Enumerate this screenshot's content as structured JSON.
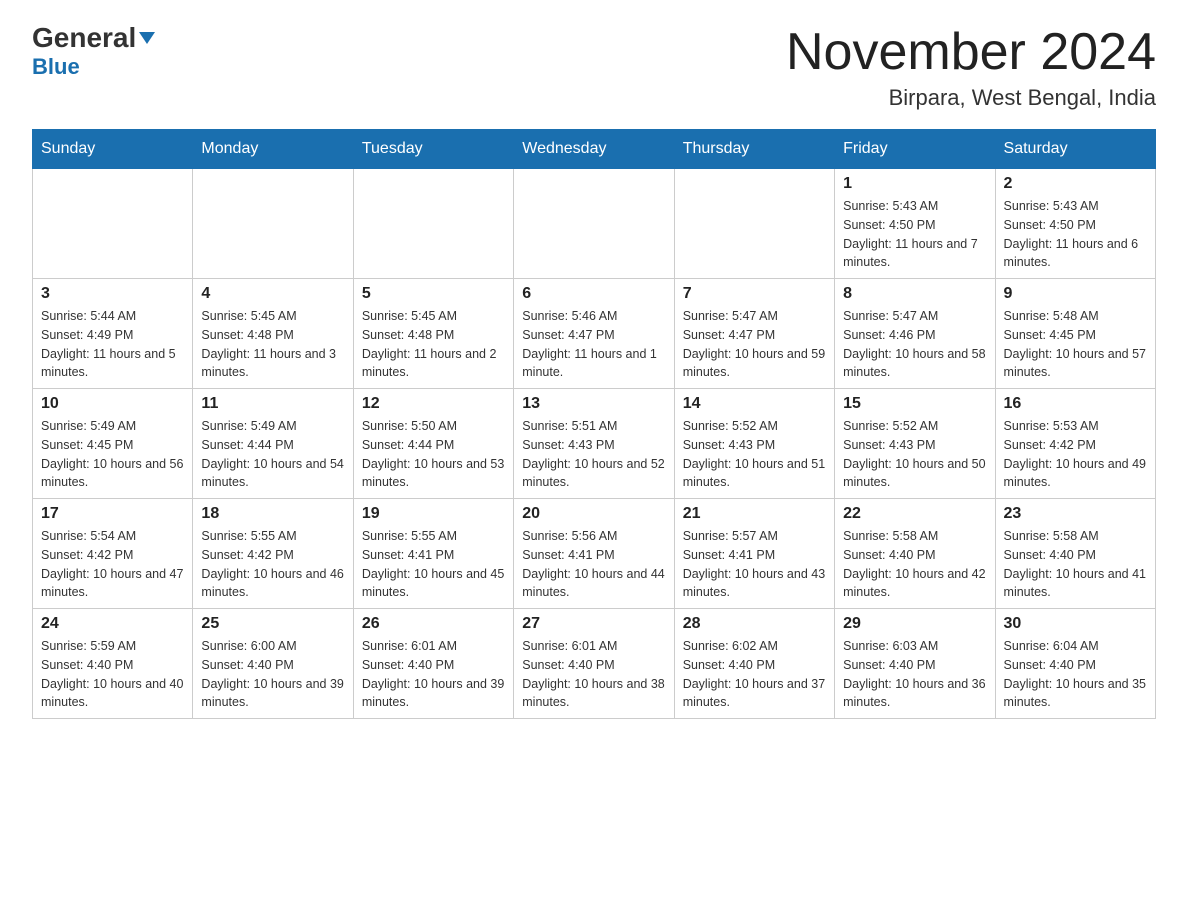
{
  "header": {
    "logo_general": "General",
    "logo_blue": "Blue",
    "month_title": "November 2024",
    "location": "Birpara, West Bengal, India"
  },
  "days_of_week": [
    "Sunday",
    "Monday",
    "Tuesday",
    "Wednesday",
    "Thursday",
    "Friday",
    "Saturday"
  ],
  "weeks": [
    [
      {
        "day": "",
        "info": ""
      },
      {
        "day": "",
        "info": ""
      },
      {
        "day": "",
        "info": ""
      },
      {
        "day": "",
        "info": ""
      },
      {
        "day": "",
        "info": ""
      },
      {
        "day": "1",
        "info": "Sunrise: 5:43 AM\nSunset: 4:50 PM\nDaylight: 11 hours and 7 minutes."
      },
      {
        "day": "2",
        "info": "Sunrise: 5:43 AM\nSunset: 4:50 PM\nDaylight: 11 hours and 6 minutes."
      }
    ],
    [
      {
        "day": "3",
        "info": "Sunrise: 5:44 AM\nSunset: 4:49 PM\nDaylight: 11 hours and 5 minutes."
      },
      {
        "day": "4",
        "info": "Sunrise: 5:45 AM\nSunset: 4:48 PM\nDaylight: 11 hours and 3 minutes."
      },
      {
        "day": "5",
        "info": "Sunrise: 5:45 AM\nSunset: 4:48 PM\nDaylight: 11 hours and 2 minutes."
      },
      {
        "day": "6",
        "info": "Sunrise: 5:46 AM\nSunset: 4:47 PM\nDaylight: 11 hours and 1 minute."
      },
      {
        "day": "7",
        "info": "Sunrise: 5:47 AM\nSunset: 4:47 PM\nDaylight: 10 hours and 59 minutes."
      },
      {
        "day": "8",
        "info": "Sunrise: 5:47 AM\nSunset: 4:46 PM\nDaylight: 10 hours and 58 minutes."
      },
      {
        "day": "9",
        "info": "Sunrise: 5:48 AM\nSunset: 4:45 PM\nDaylight: 10 hours and 57 minutes."
      }
    ],
    [
      {
        "day": "10",
        "info": "Sunrise: 5:49 AM\nSunset: 4:45 PM\nDaylight: 10 hours and 56 minutes."
      },
      {
        "day": "11",
        "info": "Sunrise: 5:49 AM\nSunset: 4:44 PM\nDaylight: 10 hours and 54 minutes."
      },
      {
        "day": "12",
        "info": "Sunrise: 5:50 AM\nSunset: 4:44 PM\nDaylight: 10 hours and 53 minutes."
      },
      {
        "day": "13",
        "info": "Sunrise: 5:51 AM\nSunset: 4:43 PM\nDaylight: 10 hours and 52 minutes."
      },
      {
        "day": "14",
        "info": "Sunrise: 5:52 AM\nSunset: 4:43 PM\nDaylight: 10 hours and 51 minutes."
      },
      {
        "day": "15",
        "info": "Sunrise: 5:52 AM\nSunset: 4:43 PM\nDaylight: 10 hours and 50 minutes."
      },
      {
        "day": "16",
        "info": "Sunrise: 5:53 AM\nSunset: 4:42 PM\nDaylight: 10 hours and 49 minutes."
      }
    ],
    [
      {
        "day": "17",
        "info": "Sunrise: 5:54 AM\nSunset: 4:42 PM\nDaylight: 10 hours and 47 minutes."
      },
      {
        "day": "18",
        "info": "Sunrise: 5:55 AM\nSunset: 4:42 PM\nDaylight: 10 hours and 46 minutes."
      },
      {
        "day": "19",
        "info": "Sunrise: 5:55 AM\nSunset: 4:41 PM\nDaylight: 10 hours and 45 minutes."
      },
      {
        "day": "20",
        "info": "Sunrise: 5:56 AM\nSunset: 4:41 PM\nDaylight: 10 hours and 44 minutes."
      },
      {
        "day": "21",
        "info": "Sunrise: 5:57 AM\nSunset: 4:41 PM\nDaylight: 10 hours and 43 minutes."
      },
      {
        "day": "22",
        "info": "Sunrise: 5:58 AM\nSunset: 4:40 PM\nDaylight: 10 hours and 42 minutes."
      },
      {
        "day": "23",
        "info": "Sunrise: 5:58 AM\nSunset: 4:40 PM\nDaylight: 10 hours and 41 minutes."
      }
    ],
    [
      {
        "day": "24",
        "info": "Sunrise: 5:59 AM\nSunset: 4:40 PM\nDaylight: 10 hours and 40 minutes."
      },
      {
        "day": "25",
        "info": "Sunrise: 6:00 AM\nSunset: 4:40 PM\nDaylight: 10 hours and 39 minutes."
      },
      {
        "day": "26",
        "info": "Sunrise: 6:01 AM\nSunset: 4:40 PM\nDaylight: 10 hours and 39 minutes."
      },
      {
        "day": "27",
        "info": "Sunrise: 6:01 AM\nSunset: 4:40 PM\nDaylight: 10 hours and 38 minutes."
      },
      {
        "day": "28",
        "info": "Sunrise: 6:02 AM\nSunset: 4:40 PM\nDaylight: 10 hours and 37 minutes."
      },
      {
        "day": "29",
        "info": "Sunrise: 6:03 AM\nSunset: 4:40 PM\nDaylight: 10 hours and 36 minutes."
      },
      {
        "day": "30",
        "info": "Sunrise: 6:04 AM\nSunset: 4:40 PM\nDaylight: 10 hours and 35 minutes."
      }
    ]
  ]
}
